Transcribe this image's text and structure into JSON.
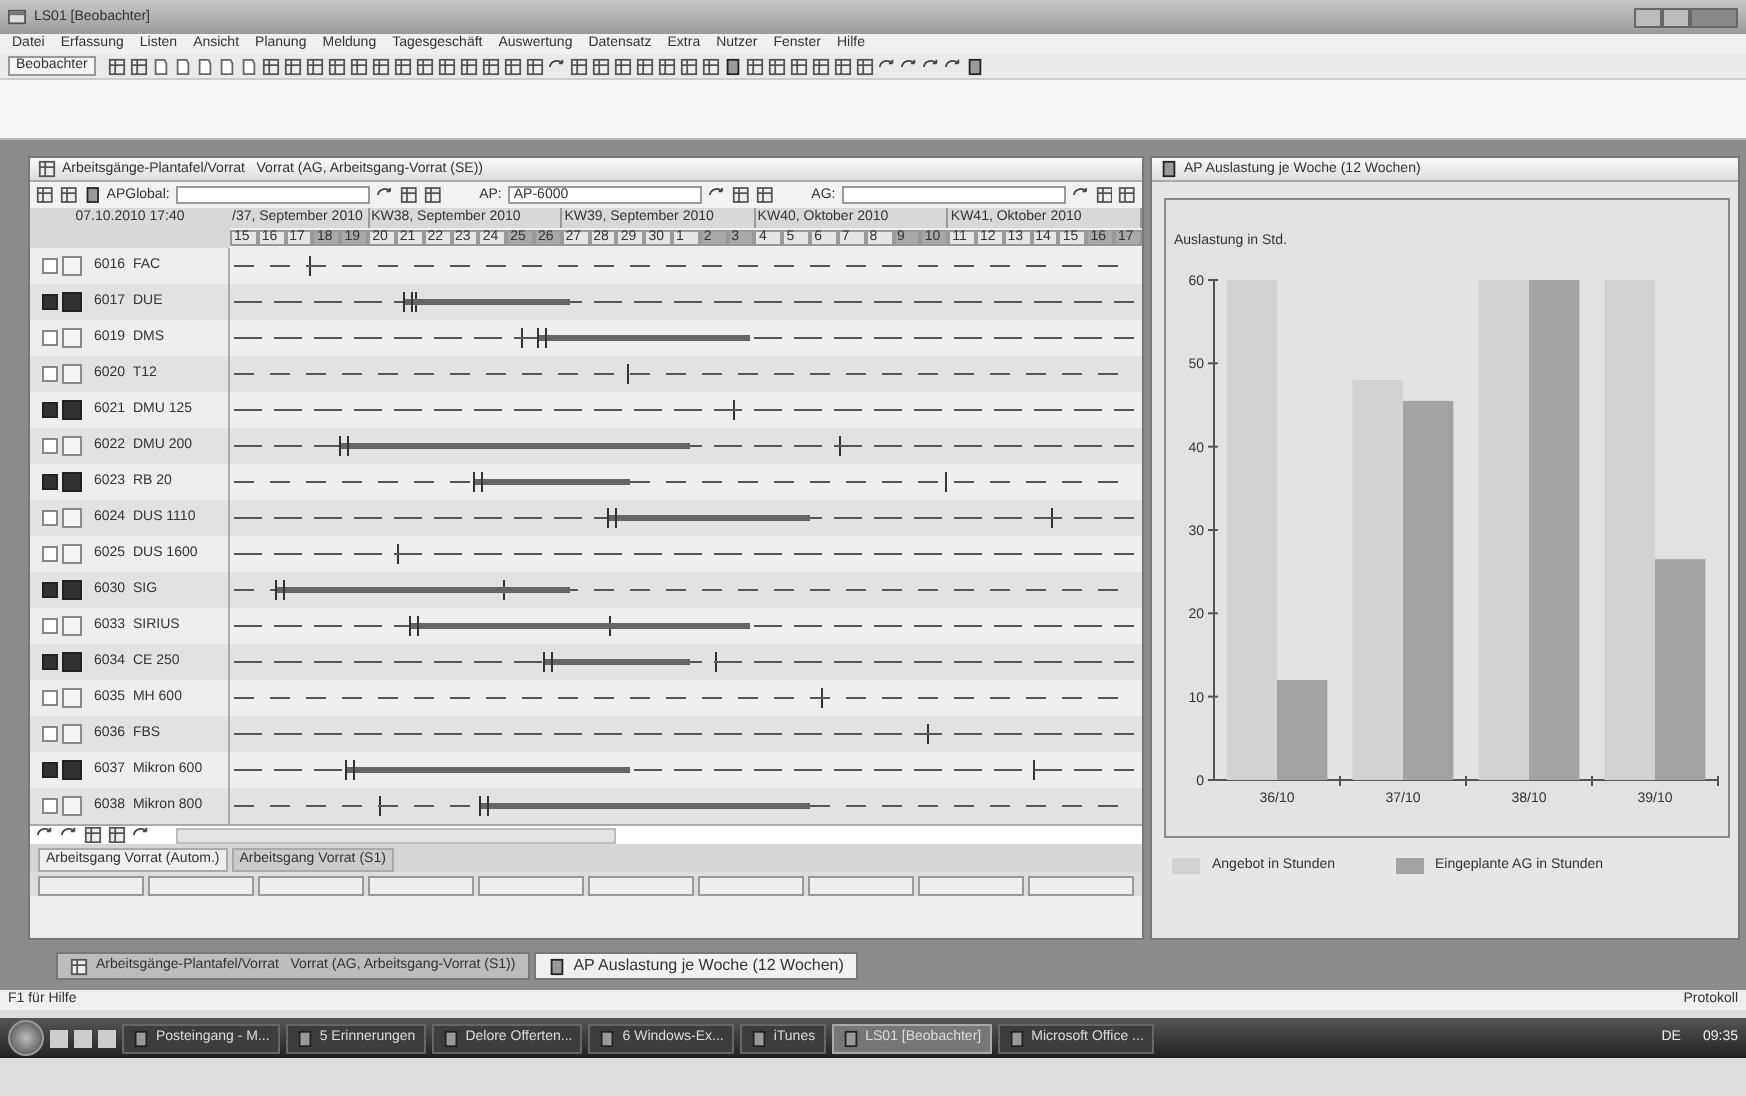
{
  "window": {
    "title": "LS01 [Beobachter]"
  },
  "menu": [
    "Datei",
    "Erfassung",
    "Listen",
    "Ansicht",
    "Planung",
    "Meldung",
    "Tagesgeschäft",
    "Auswertung",
    "Datensatz",
    "Extra",
    "Nutzer",
    "Fenster",
    "Hilfe"
  ],
  "toolbar": {
    "user": "Beobachter"
  },
  "plan_panel": {
    "title": "Arbeitsgänge-Plantafel/Vorrat   Vorrat (AG, Arbeitsgang-Vorrat (SE))",
    "filters": [
      {
        "label": "APGlobal:"
      },
      {
        "label": "AP:",
        "value": "AP-6000"
      },
      {
        "label": "AG:"
      }
    ],
    "timestamp": "07.10.2010 17:40",
    "weeks": [
      {
        "label": "/37, September 2010",
        "days": [
          {
            "day": "15",
            "weekend": false
          },
          {
            "day": "16",
            "weekend": false
          },
          {
            "day": "17",
            "weekend": false
          },
          {
            "day": "18",
            "weekend": true
          },
          {
            "day": "19",
            "weekend": true
          }
        ]
      },
      {
        "label": "KW38, September 2010",
        "days": [
          {
            "day": "20",
            "weekend": false
          },
          {
            "day": "21",
            "weekend": false
          },
          {
            "day": "22",
            "weekend": false
          },
          {
            "day": "23",
            "weekend": false
          },
          {
            "day": "24",
            "weekend": false
          },
          {
            "day": "25",
            "weekend": true
          },
          {
            "day": "26",
            "weekend": true
          }
        ]
      },
      {
        "label": "KW39, September 2010",
        "days": [
          {
            "day": "27",
            "weekend": false
          },
          {
            "day": "28",
            "weekend": false
          },
          {
            "day": "29",
            "weekend": false
          },
          {
            "day": "30",
            "weekend": false
          },
          {
            "day": "1",
            "weekend": false
          },
          {
            "day": "2",
            "weekend": true
          },
          {
            "day": "3",
            "weekend": true
          }
        ]
      },
      {
        "label": "KW40, Oktober 2010",
        "days": [
          {
            "day": "4",
            "weekend": false
          },
          {
            "day": "5",
            "weekend": false
          },
          {
            "day": "6",
            "weekend": false
          },
          {
            "day": "7",
            "weekend": false
          },
          {
            "day": "8",
            "weekend": false
          },
          {
            "day": "9",
            "weekend": true
          },
          {
            "day": "10",
            "weekend": true
          }
        ]
      },
      {
        "label": "KW41, Oktober 2010",
        "days": [
          {
            "day": "11",
            "weekend": false
          },
          {
            "day": "12",
            "weekend": false
          },
          {
            "day": "13",
            "weekend": false
          },
          {
            "day": "14",
            "weekend": false
          },
          {
            "day": "15",
            "weekend": false
          },
          {
            "day": "16",
            "weekend": true
          },
          {
            "day": "17",
            "weekend": true
          }
        ]
      }
    ],
    "rows": [
      {
        "id": "6016",
        "name": "FAC",
        "selected": false
      },
      {
        "id": "6017",
        "name": "DUE",
        "selected": true
      },
      {
        "id": "6019",
        "name": "DMS",
        "selected": false
      },
      {
        "id": "6020",
        "name": "T12",
        "selected": false
      },
      {
        "id": "6021",
        "name": "DMU 125",
        "selected": true
      },
      {
        "id": "6022",
        "name": "DMU 200",
        "selected": false
      },
      {
        "id": "6023",
        "name": "RB 20",
        "selected": true
      },
      {
        "id": "6024",
        "name": "DUS 1110",
        "selected": false
      },
      {
        "id": "6025",
        "name": "DUS 1600",
        "selected": false
      },
      {
        "id": "6030",
        "name": "SIG",
        "selected": true
      },
      {
        "id": "6033",
        "name": "SIRIUS",
        "selected": false
      },
      {
        "id": "6034",
        "name": "CE 250",
        "selected": true
      },
      {
        "id": "6035",
        "name": "MH 600",
        "selected": false
      },
      {
        "id": "6036",
        "name": "FBS",
        "selected": false
      },
      {
        "id": "6037",
        "name": "Mikron 600",
        "selected": true
      },
      {
        "id": "6038",
        "name": "Mikron 800",
        "selected": false
      }
    ],
    "tabs": [
      {
        "label": "Arbeitsgang Vorrat (Autom.)",
        "selected": true
      },
      {
        "label": "Arbeitsgang Vorrat (S1)",
        "selected": false
      }
    ]
  },
  "chart_panel": {
    "title": "AP Auslastung je Woche (12 Wochen)",
    "chart_data": {
      "type": "bar",
      "ylabel": "Auslastung in Std.",
      "categories": [
        "36/10",
        "37/10",
        "38/10",
        "39/10"
      ],
      "series": [
        {
          "name": "Angebot in Stunden",
          "color": "#d2d2d2",
          "values": [
            60,
            48,
            60,
            60
          ]
        },
        {
          "name": "Eingeplante AG in Stunden",
          "color": "#a3a3a3",
          "values": [
            12,
            45.5,
            60,
            26.5
          ]
        }
      ],
      "ylim": [
        0,
        60
      ],
      "yticks": [
        0,
        10,
        20,
        30,
        40,
        50,
        60
      ]
    }
  },
  "window_tabs": [
    {
      "label": "Arbeitsgänge-Plantafel/Vorrat   Vorrat (AG, Arbeitsgang-Vorrat (S1))",
      "selected": false
    },
    {
      "label": "AP Auslastung je Woche (12 Wochen)",
      "selected": true
    }
  ],
  "status_bar": {
    "help": "F1 für Hilfe",
    "log": "Protokoll"
  },
  "taskbar": {
    "items": [
      {
        "label": "Posteingang - M...",
        "selected": false
      },
      {
        "label": "5 Erinnerungen",
        "selected": false
      },
      {
        "label": "Delore Offerten...",
        "selected": false
      },
      {
        "label": "6 Windows-Ex...",
        "selected": false
      },
      {
        "label": "iTunes",
        "selected": false
      },
      {
        "label": "LS01 [Beobachter]",
        "selected": true
      },
      {
        "label": "Microsoft Office ...",
        "selected": false
      }
    ],
    "language": "DE",
    "clock": "09:35"
  }
}
